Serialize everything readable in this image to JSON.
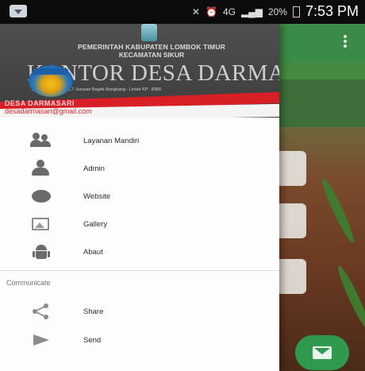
{
  "status_bar": {
    "signal_label": "4G",
    "battery": "20%",
    "time": "7:53 PM"
  },
  "drawer": {
    "header": {
      "line1": "PEMERINTAH KABUPATEN LOMBOK TIMUR",
      "line2": "KECAMATAN SIKUR",
      "title": "KANTOR DESA DARMASARI",
      "address": "Jl. Darmasari, km .1,7 Jurusan Bagek Bongkang - Lintek KP : 8366",
      "account_name": "DESA DARMASARI",
      "account_email": "desadarmasari@gmail.com"
    },
    "menu": [
      {
        "label": "Layanan Mandiri",
        "icon": "people-icon"
      },
      {
        "label": "Admin",
        "icon": "person-icon"
      },
      {
        "label": "Website",
        "icon": "globe-icon"
      },
      {
        "label": "Gallery",
        "icon": "image-icon"
      },
      {
        "label": "Abaut",
        "icon": "android-icon"
      }
    ],
    "section_title": "Communicate",
    "communicate": [
      {
        "label": "Share",
        "icon": "share-icon"
      },
      {
        "label": "Send",
        "icon": "send-icon"
      }
    ]
  },
  "colors": {
    "toolbar": "#3a8b48",
    "fab": "#2f9a4d",
    "header_red": "#d81f26",
    "email": "#e2262c"
  }
}
